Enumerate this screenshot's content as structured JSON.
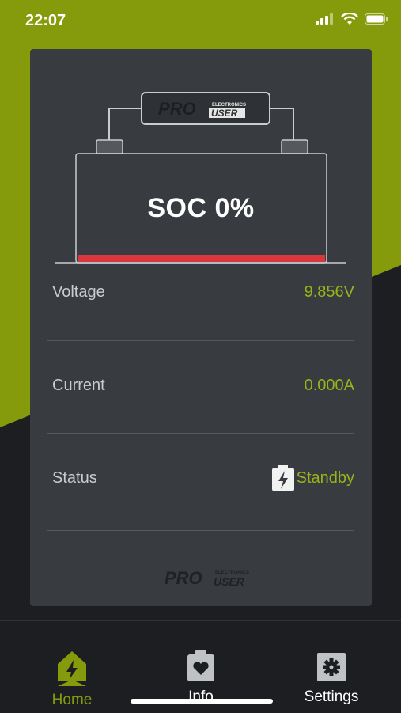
{
  "status_bar": {
    "time": "22:07"
  },
  "battery": {
    "soc_text": "SOC 0%",
    "soc_percent": 0
  },
  "brand": {
    "logo_text_pro": "PRO",
    "logo_text_user": "USER",
    "logo_text_small": "ELECTRONICS"
  },
  "readings": {
    "voltage": {
      "label": "Voltage",
      "value": "9.856V"
    },
    "current": {
      "label": "Current",
      "value": "0.000A"
    },
    "status": {
      "label": "Status",
      "value": "Standby",
      "icon": "battery-charging-icon"
    }
  },
  "tabs": [
    {
      "label": "Home",
      "icon": "home-icon",
      "active": true
    },
    {
      "label": "Info",
      "icon": "battery-heart-icon",
      "active": false
    },
    {
      "label": "Settings",
      "icon": "gear-icon",
      "active": false
    }
  ],
  "colors": {
    "accent": "#869b0c",
    "value": "#9bb21a",
    "card": "#383b40",
    "bg_dark": "#1c1e22",
    "battery_bar": "#d9363e"
  }
}
